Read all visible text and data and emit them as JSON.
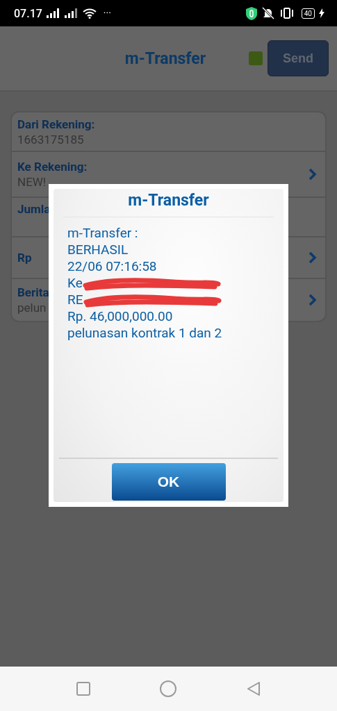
{
  "status_bar": {
    "time": "07.17",
    "more": "···",
    "battery": "40"
  },
  "header": {
    "title": "m-Transfer",
    "send_button": "Send"
  },
  "form": {
    "rows": [
      {
        "label": "Dari Rekening:",
        "value": "1663175185",
        "chevron": false
      },
      {
        "label": "Ke Rekening:",
        "value": "NEW!",
        "chevron": true
      },
      {
        "label": "Jumla",
        "chevron": false
      },
      {
        "label": "Rp",
        "chevron": true
      },
      {
        "label": "Berita",
        "value": "pelun",
        "chevron": true
      }
    ]
  },
  "dialog": {
    "title": "m-Transfer",
    "lines": [
      {
        "text": "m-Transfer :",
        "redacted": false
      },
      {
        "text": "BERHASIL",
        "redacted": false
      },
      {
        "text": "22/06 07:16:58",
        "redacted": false
      },
      {
        "text": "Ke",
        "redacted": true
      },
      {
        "text": "RE",
        "redacted": true
      },
      {
        "text": "Rp. 46,000,000.00",
        "redacted": false
      },
      {
        "text": "pelunasan kontrak 1 dan 2",
        "redacted": false
      }
    ],
    "button": "OK"
  }
}
